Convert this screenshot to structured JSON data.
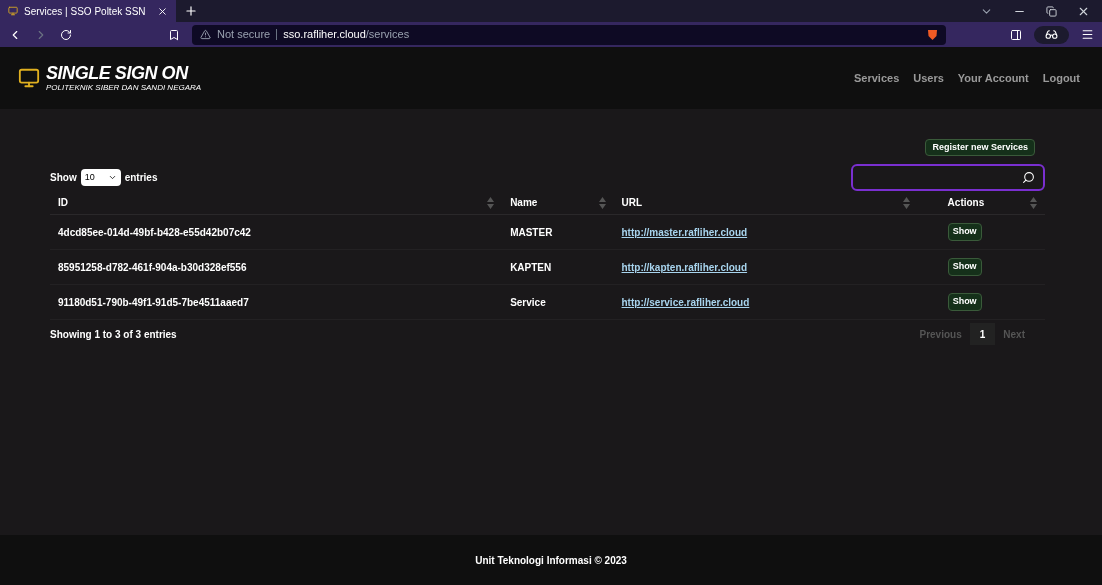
{
  "browser": {
    "tab_title": "Services | SSO Poltek SSN",
    "security": "Not secure",
    "url_host": "sso.rafliher.cloud",
    "url_path": "/services"
  },
  "header": {
    "logo_title": "SINGLE SIGN ON",
    "logo_subtitle": "POLITEKNIK SIBER DAN SANDI NEGARA",
    "nav": [
      {
        "label": "Services"
      },
      {
        "label": "Users"
      },
      {
        "label": "Your Account"
      },
      {
        "label": "Logout"
      }
    ]
  },
  "register_button": "Register new Services",
  "length": {
    "before": "Show",
    "value": "10",
    "after": "entries"
  },
  "table": {
    "columns": [
      {
        "label": "ID",
        "sortable": true
      },
      {
        "label": "Name",
        "sortable": true
      },
      {
        "label": "URL",
        "sortable": true
      },
      {
        "label": "Actions",
        "sortable": true
      }
    ],
    "rows": [
      {
        "id": "4dcd85ee-014d-49bf-b428-e55d42b07c42",
        "name": "MASTER",
        "url": "http://master.rafliher.cloud",
        "action": "Show"
      },
      {
        "id": "85951258-d782-461f-904a-b30d328ef556",
        "name": "KAPTEN",
        "url": "http://kapten.rafliher.cloud",
        "action": "Show"
      },
      {
        "id": "91180d51-790b-49f1-91d5-7be4511aaed7",
        "name": "Service",
        "url": "http://service.rafliher.cloud",
        "action": "Show"
      }
    ]
  },
  "info": "Showing 1 to 3 of 3 entries",
  "pagination": {
    "previous": "Previous",
    "pages": [
      {
        "label": "1",
        "selected": true
      }
    ],
    "next": "Next"
  },
  "footer": "Unit Teknologi Informasi © 2023"
}
